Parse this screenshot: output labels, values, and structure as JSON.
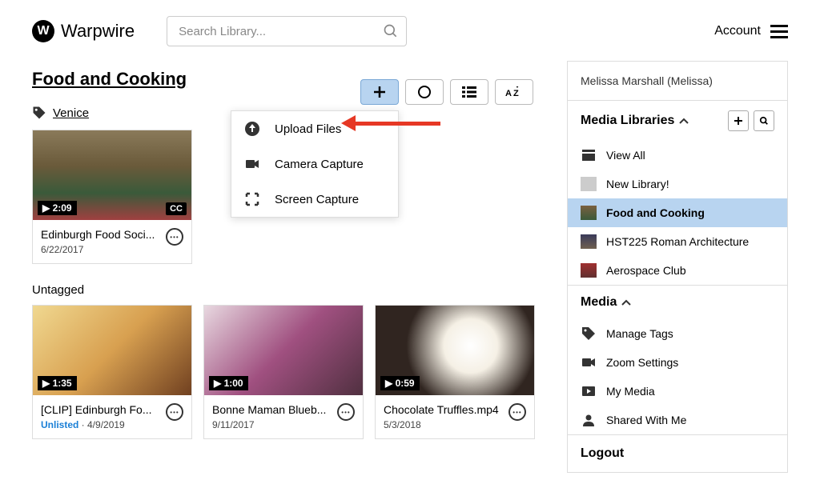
{
  "brand": "Warpwire",
  "search": {
    "placeholder": "Search Library..."
  },
  "account": {
    "label": "Account"
  },
  "page_title": "Food and Cooking",
  "toolbar": {
    "buttons": [
      "add",
      "record",
      "list",
      "sort"
    ]
  },
  "dropdown": {
    "items": [
      {
        "icon": "upload",
        "label": "Upload Files"
      },
      {
        "icon": "camera",
        "label": "Camera Capture"
      },
      {
        "icon": "screen",
        "label": "Screen Capture"
      }
    ]
  },
  "tag": {
    "name": "Venice"
  },
  "tagged_videos": [
    {
      "title": "Edinburgh Food Soci...",
      "date": "6/22/2017",
      "duration": "2:09",
      "cc": "CC",
      "thumb_class": "thumb1"
    }
  ],
  "untagged_label": "Untagged",
  "untagged_videos": [
    {
      "title": "[CLIP] Edinburgh Fo...",
      "status": "Unlisted",
      "date": "4/9/2019",
      "duration": "1:35",
      "thumb_class": "thumb2"
    },
    {
      "title": "Bonne Maman Blueb...",
      "date": "9/11/2017",
      "duration": "1:00",
      "thumb_class": "thumb3"
    },
    {
      "title": "Chocolate Truffles.mp4",
      "date": "5/3/2018",
      "duration": "0:59",
      "thumb_class": "thumb4"
    }
  ],
  "sidebar": {
    "user": "Melissa Marshall (Melissa)",
    "libraries_head": "Media Libraries",
    "libraries": [
      {
        "label": "View All",
        "icon": "stack"
      },
      {
        "label": "New Library!",
        "icon": "blank"
      },
      {
        "label": "Food and Cooking",
        "icon": "food",
        "active": true
      },
      {
        "label": "HST225 Roman Architecture",
        "icon": "roman"
      },
      {
        "label": "Aerospace Club",
        "icon": "aero"
      }
    ],
    "media_head": "Media",
    "media": [
      {
        "label": "Manage Tags",
        "icon": "tag"
      },
      {
        "label": "Zoom Settings",
        "icon": "camera"
      },
      {
        "label": "My Media",
        "icon": "play"
      },
      {
        "label": "Shared With Me",
        "icon": "person"
      }
    ],
    "logout": "Logout"
  }
}
